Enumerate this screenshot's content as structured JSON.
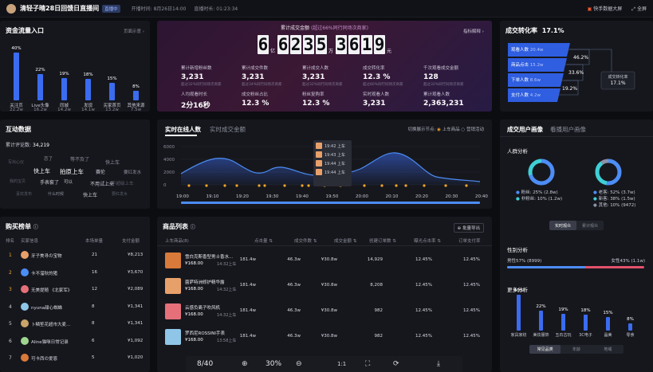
{
  "header": {
    "title": "清轻子晴28日回馈日直播间",
    "badge": "直播中",
    "start_time": "开播时间: 8月26日14:00",
    "duration": "直播时长: 01:23:34",
    "bigscreen": "快手数据大屏",
    "fullscreen": "全屏"
  },
  "fund": {
    "title": "资金流量入口",
    "link": "页面示意 ›",
    "bars": [
      {
        "pct": "40%",
        "label": "关注页",
        "val": "22.2w",
        "ratio": 0.4
      },
      {
        "pct": "22%",
        "label": "Live头像",
        "val": "16.2w",
        "ratio": 0.22
      },
      {
        "pct": "19%",
        "label": "同城",
        "val": "14.2w",
        "ratio": 0.19
      },
      {
        "pct": "18%",
        "label": "发现",
        "val": "14.1w",
        "ratio": 0.18
      },
      {
        "pct": "15%",
        "label": "买家首页",
        "val": "13.2w",
        "ratio": 0.15
      },
      {
        "pct": "8%",
        "label": "其他来源",
        "val": "7.5w",
        "ratio": 0.08
      }
    ]
  },
  "hero": {
    "caption": "累计成交金额",
    "caption_note": "(超过66%同行同场次商家)",
    "digits": [
      "6",
      "6",
      "2",
      "3",
      "5",
      "3",
      "6",
      "1",
      "9"
    ],
    "unit_wan": "万",
    "unit_yi": "亿",
    "unit_yuan": "元",
    "guide": "指标解释 ›",
    "metrics": [
      {
        "label": "累计新增粉丝数",
        "value": "3,231",
        "note": "超过32%同行同场次商家"
      },
      {
        "label": "累计成交件数",
        "value": "3,231",
        "note": "超过34%同行同场次商家"
      },
      {
        "label": "累计成交人数",
        "value": "3,231",
        "note": "超过32%同行同场次商家"
      },
      {
        "label": "成交转化率",
        "value": "12.3 %",
        "note": "超过80%同行同场次商家"
      },
      {
        "label": "千次观看成交金额",
        "value": "128",
        "note": "超过32%同行同场次商家"
      },
      {
        "label": "人均观看时长",
        "value": "2分16秒",
        "note": ""
      },
      {
        "label": "成交粉丝占比",
        "value": "12.3 %",
        "note": ""
      },
      {
        "label": "粉丝复购率",
        "value": "12.3 %",
        "note": ""
      },
      {
        "label": "实时观看人数",
        "value": "3,231",
        "note": ""
      },
      {
        "label": "累计观看人数",
        "value": "2,363,231",
        "note": ""
      }
    ]
  },
  "conversion": {
    "title": "成交转化率",
    "rate": "17.1%",
    "steps": [
      {
        "label": "观看人数",
        "value": "20.4w"
      },
      {
        "label": "商品点击",
        "value": "15.2w"
      },
      {
        "label": "下单人数",
        "value": "8.6w"
      },
      {
        "label": "支付人数",
        "value": "4.2w"
      }
    ],
    "pcts": [
      "46.2%",
      "33.6%",
      "19.2%"
    ],
    "box_label": "成交转化率",
    "box_val": "17.1%"
  },
  "online": {
    "tab1": "实时在线人数",
    "tab2": "实时成交金额",
    "switch_label": "切换展示节点:",
    "opt1": "上车商品",
    "opt2": "营销活动",
    "yticks": [
      "6000",
      "4000",
      "2000",
      "0"
    ],
    "xticks": [
      "19:00",
      "19:10",
      "19:20",
      "19:30",
      "19:40",
      "19:50",
      "20:00",
      "20:10",
      "20:20",
      "20:30",
      "20:40"
    ],
    "tip": [
      "19:42 上车",
      "19:43 上车",
      "19:44 上车",
      "19:44 上车"
    ]
  },
  "interact": {
    "title": "互动数据",
    "count_label": "累计评论数:",
    "count": "34,219",
    "words": [
      "写出心仪",
      "恋了",
      "等不及了",
      "快上车",
      "快上车",
      "拍原上车",
      "赛伦",
      "要红发水",
      "我的宝贝",
      "手表套了",
      "可以",
      "不用试上来",
      "不超级上车",
      "喜欢发布",
      "什么时候",
      "快上车",
      "要红发水"
    ]
  },
  "portrait": {
    "tab1": "成交用户画像",
    "tab2": "看播用户画像",
    "crowd": "人群分析",
    "ring1": [
      {
        "label": "粉丝",
        "val": "25% (2.8w)"
      },
      {
        "label": "非粉丝",
        "val": "10% (1.2w)"
      }
    ],
    "ring2": [
      {
        "label": "老客",
        "val": "52% (3.7w)"
      },
      {
        "label": "新客",
        "val": "38% (1.5w)"
      },
      {
        "label": "其他",
        "val": "10% (9472)"
      }
    ],
    "seg1": "实时观众",
    "seg2": "累计观众",
    "gender": "性别分析",
    "male": "男性57% (8999)",
    "female": "女性43% (1.1w)",
    "more": "更多分析",
    "more_bars": [
      {
        "pct": "40%",
        "label": "家具家纺",
        "ratio": 0.4
      },
      {
        "pct": "22%",
        "label": "美妆服饰",
        "ratio": 0.22
      },
      {
        "pct": "19%",
        "label": "五石古玩",
        "ratio": 0.19
      },
      {
        "pct": "18%",
        "label": "3C电子",
        "ratio": 0.18
      },
      {
        "pct": "15%",
        "label": "晶美",
        "ratio": 0.15
      },
      {
        "pct": "8%",
        "label": "零食",
        "ratio": 0.08
      }
    ],
    "btabs": [
      "常见品类",
      "年龄",
      "地域"
    ]
  },
  "buy": {
    "title": "购买榜单",
    "cols": [
      "排名",
      "买家信息",
      "本场单量",
      "支付金额"
    ],
    "rows": [
      {
        "rank": "1",
        "name": "牙子美寻の宝物",
        "qty": "21",
        "amt": "¥8,213"
      },
      {
        "rank": "2",
        "name": "卡不溜秋的猪",
        "qty": "16",
        "amt": "¥3,670"
      },
      {
        "rank": "3",
        "name": "无美提随 《北家军》",
        "qty": "12",
        "amt": "¥2,089"
      },
      {
        "rank": "4",
        "name": "nyuna甜心蜘蛛",
        "qty": "8",
        "amt": "¥1,341"
      },
      {
        "rank": "5",
        "name": "卜鳞笙花超市大麦...",
        "qty": "8",
        "amt": "¥1,341"
      },
      {
        "rank": "6",
        "name": "Aline猫咪日常记录",
        "qty": "6",
        "amt": "¥1,092"
      },
      {
        "rank": "7",
        "name": "可卡西の爱恩",
        "qty": "5",
        "amt": "¥1,020"
      }
    ]
  },
  "goods": {
    "title": "商品列表",
    "export": "批量导出",
    "cols": [
      "上车商品(8)",
      "点击量 ⇅",
      "成交件数 ⇅",
      "成交金额 ⇅",
      "创建订单数 ⇅",
      "曝光点击率 ⇅",
      "订单支付率"
    ],
    "rows": [
      {
        "name": "雪白克斯香型男士香水...",
        "price": "¥168.00",
        "time": "14:32上车",
        "clicks": "181.4w",
        "qty": "46.3w",
        "amt": "¥30.8w",
        "orders": "14,929",
        "ctr": "12.45%",
        "pay": "12.45%",
        "color": "#d87a3a"
      },
      {
        "name": "菌萨特洲修护精华露",
        "price": "¥168.00",
        "time": "14:32上车",
        "clicks": "181.4w",
        "qty": "46.3w",
        "amt": "¥30.8w",
        "orders": "8,208",
        "ctr": "12.45%",
        "pay": "12.45%",
        "color": "#e8a06a"
      },
      {
        "name": "云感负离子吹风机",
        "price": "¥168.00",
        "time": "14:32上车",
        "clicks": "181.4w",
        "qty": "46.3w",
        "amt": "¥30.8w",
        "orders": "982",
        "ctr": "12.45%",
        "pay": "12.45%",
        "color": "#e5707a"
      },
      {
        "name": "罗西尼ROSSINI手表",
        "price": "¥168.00",
        "time": "13:58上车",
        "clicks": "181.4w",
        "qty": "46.3w",
        "amt": "¥30.8w",
        "orders": "982",
        "ctr": "12.45%",
        "pay": "12.45%",
        "color": "#8fc6e8"
      }
    ]
  },
  "viewer": {
    "page": "8/40",
    "zoom": "30%"
  }
}
